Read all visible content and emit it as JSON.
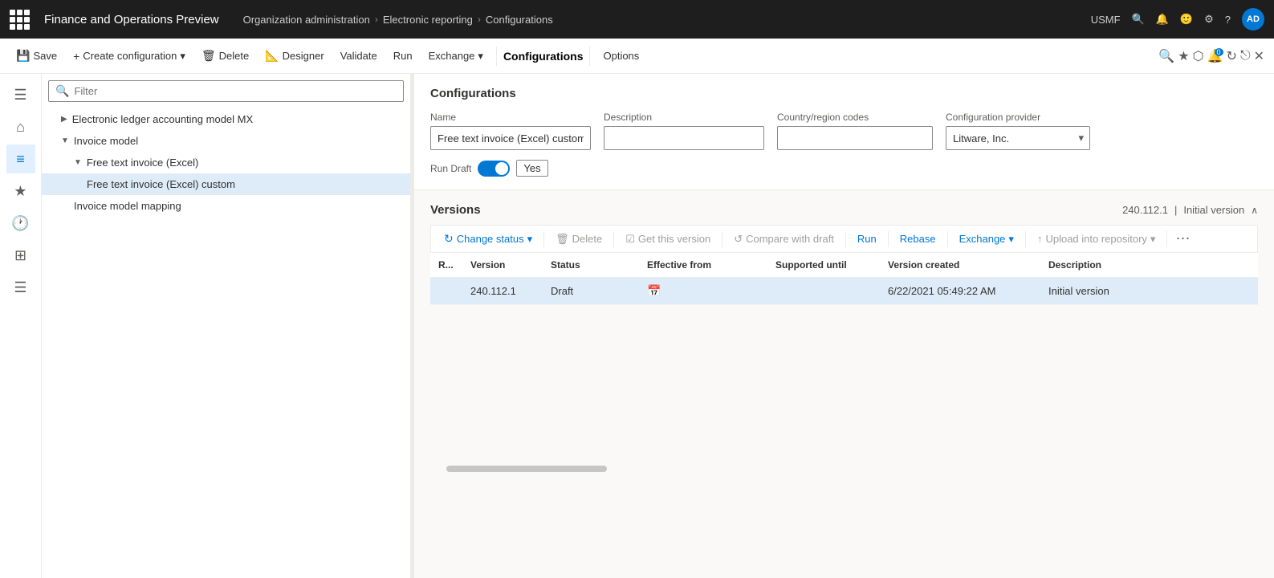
{
  "topBar": {
    "gridLabel": "Apps",
    "title": "Finance and Operations Preview",
    "breadcrumbs": [
      "Organization administration",
      "Electronic reporting",
      "Configurations"
    ],
    "orgLabel": "USMF",
    "avatarLabel": "AD"
  },
  "commandBar": {
    "save": "Save",
    "createConfiguration": "Create configuration",
    "delete": "Delete",
    "designer": "Designer",
    "validate": "Validate",
    "run": "Run",
    "exchange": "Exchange",
    "configurationsLabel": "Configurations",
    "options": "Options"
  },
  "sideNav": {
    "icons": [
      "home",
      "star",
      "clock",
      "grid",
      "list"
    ]
  },
  "treePanel": {
    "filterPlaceholder": "Filter",
    "items": [
      {
        "label": "Electronic ledger accounting model MX",
        "indent": 1,
        "collapsed": false
      },
      {
        "label": "Invoice model",
        "indent": 1,
        "collapsed": false
      },
      {
        "label": "Free text invoice (Excel)",
        "indent": 2,
        "collapsed": false
      },
      {
        "label": "Free text invoice (Excel) custom",
        "indent": 3,
        "selected": true
      },
      {
        "label": "Invoice model mapping",
        "indent": 2
      }
    ]
  },
  "configPanel": {
    "sectionTitle": "Configurations",
    "fields": {
      "nameLabel": "Name",
      "nameValue": "Free text invoice (Excel) custom",
      "descriptionLabel": "Description",
      "descriptionValue": "",
      "countryLabel": "Country/region codes",
      "countryValue": "",
      "providerLabel": "Configuration provider",
      "providerValue": "Litware, Inc."
    },
    "runDraft": {
      "label": "Run Draft",
      "value": "Yes"
    }
  },
  "versionsSection": {
    "title": "Versions",
    "versionInfo": "240.112.1",
    "versionLabel": "Initial version",
    "toolbar": {
      "changeStatus": "Change status",
      "delete": "Delete",
      "getThisVersion": "Get this version",
      "compareWithDraft": "Compare with draft",
      "run": "Run",
      "rebase": "Rebase",
      "exchange": "Exchange",
      "uploadIntoRepository": "Upload into repository"
    },
    "table": {
      "columns": [
        "R...",
        "Version",
        "Status",
        "Effective from",
        "Supported until",
        "Version created",
        "Description"
      ],
      "rows": [
        {
          "r": "",
          "version": "240.112.1",
          "status": "Draft",
          "effectiveFrom": "",
          "supportedUntil": "",
          "versionCreated": "6/22/2021 05:49:22 AM",
          "description": "Initial version",
          "selected": true
        }
      ]
    }
  }
}
